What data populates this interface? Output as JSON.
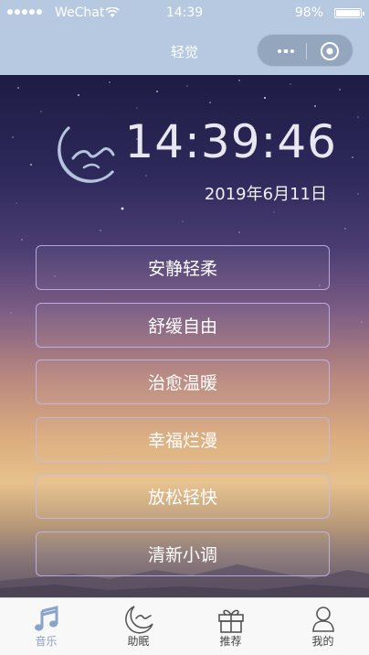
{
  "status_bar": {
    "carrier": "WeChat",
    "time": "14:39",
    "battery": "98%"
  },
  "nav": {
    "title": "轻觉"
  },
  "main": {
    "clock": "14:39:46",
    "date": "2019年6月11日",
    "buttons": [
      "安静轻柔",
      "舒缓自由",
      "治愈温暖",
      "幸福烂漫",
      "放松轻快",
      "清新小调"
    ]
  },
  "tabs": [
    {
      "label": "音乐",
      "icon": "music-note-icon"
    },
    {
      "label": "助眠",
      "icon": "moon-icon"
    },
    {
      "label": "推荐",
      "icon": "gift-icon"
    },
    {
      "label": "我的",
      "icon": "user-icon"
    }
  ],
  "colors": {
    "nav_background": "#b6c9e0",
    "active_tab": "#8aa4c8",
    "button_border": "#c4b7f0"
  }
}
